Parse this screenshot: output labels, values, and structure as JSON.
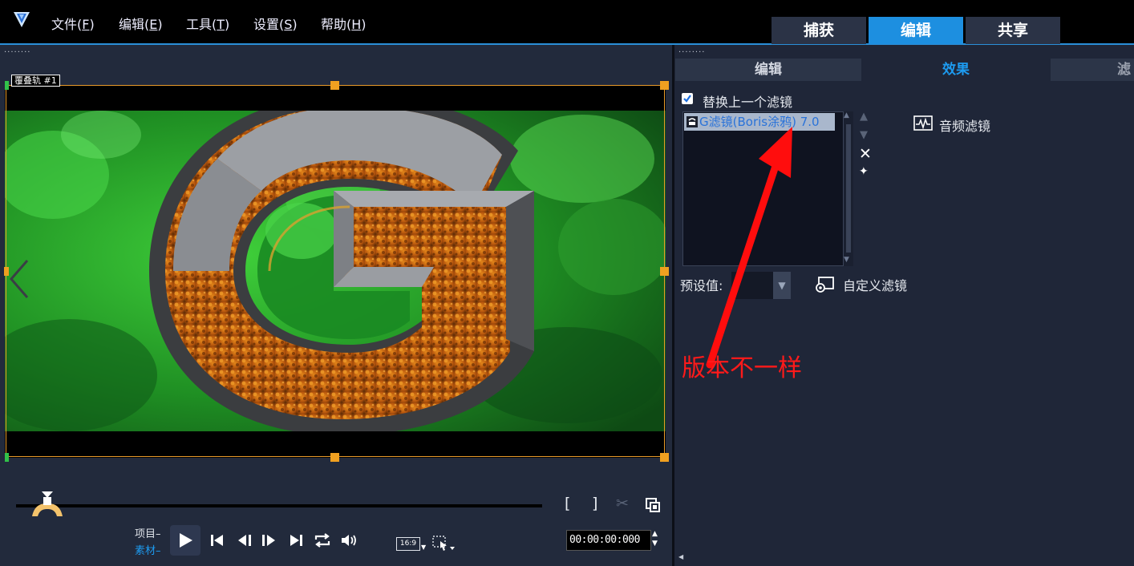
{
  "menu": {
    "file": "文件(",
    "file_key": "F",
    "edit": "编辑(",
    "edit_key": "E",
    "tools": "工具(",
    "tools_key": "T",
    "settings": "设置(",
    "settings_key": "S",
    "help": "帮助(",
    "help_key": "H",
    "close": ")"
  },
  "modes": {
    "capture": "捕获",
    "edit": "编辑",
    "share": "共享",
    "active": "edit"
  },
  "preview": {
    "track_label": "覆叠轨 #1",
    "project_label": "项目",
    "clip_label": "素材",
    "timecode": "00:00:00:000",
    "aspect": "16:9"
  },
  "right_tabs": {
    "edit": "编辑",
    "effects": "效果",
    "partial": "滤",
    "active": "effects"
  },
  "effects": {
    "replace_filter_label": "替换上一个滤镜",
    "replace_filter_checked": true,
    "filter_items": [
      "G滤镜(Boris涂鸦) 7.0"
    ],
    "audio_filter_label": "音频滤镜",
    "preset_label": "预设值:",
    "custom_filter_label": "自定义滤镜"
  },
  "annotation": {
    "text": "版本不一样",
    "color": "#ff1a1a"
  },
  "colors": {
    "accent": "#1d8fe0",
    "panel": "#1f2638",
    "handle": "#f0a020"
  }
}
